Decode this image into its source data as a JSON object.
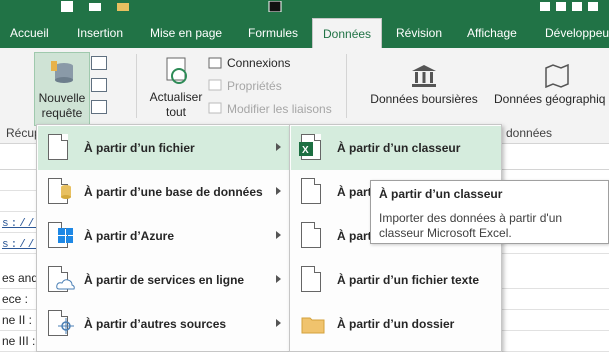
{
  "tabs": [
    {
      "label": "Accueil"
    },
    {
      "label": "Insertion"
    },
    {
      "label": "Mise en page"
    },
    {
      "label": "Formules"
    },
    {
      "label": "Données"
    },
    {
      "label": "Révision"
    },
    {
      "label": "Affichage"
    },
    {
      "label": "Développeur"
    }
  ],
  "ribbon": {
    "nouvelle_requete_line1": "Nouvelle",
    "nouvelle_requete_line2": "requête",
    "actualiser_line1": "Actualiser",
    "actualiser_line2": "tout",
    "connexions": "Connexions",
    "proprietes": "Propriétés",
    "modifier_liaisons": "Modifier les liaisons",
    "donnees_boursieres": "Données boursières",
    "donnees_geographiques": "Données géographiq",
    "group_recup": "Récup",
    "group_types": "données"
  },
  "menu": {
    "items": [
      {
        "label": "À partir d’un fichier"
      },
      {
        "label": "À partir d’une base de données"
      },
      {
        "label": "À partir d’Azure"
      },
      {
        "label": "À partir de services en ligne"
      },
      {
        "label": "À partir d’autres sources"
      }
    ]
  },
  "submenu": {
    "items": [
      {
        "label": "À partir d’un classeur"
      },
      {
        "label": "À parti"
      },
      {
        "label": "À parti"
      },
      {
        "label": "À partir d’un fichier texte"
      },
      {
        "label": "À partir d’un dossier"
      }
    ]
  },
  "tooltip": {
    "title": "À partir d’un classeur",
    "description": "Importer des données à partir d'un classeur Microsoft Excel."
  },
  "sheet": {
    "link1": "s://w",
    "link2": "s://w",
    "rows": [
      "es and",
      "ece :",
      "ne II :",
      "ne III :"
    ]
  },
  "colors": {
    "accent": "#217346",
    "highlight": "#d5ecdd"
  }
}
